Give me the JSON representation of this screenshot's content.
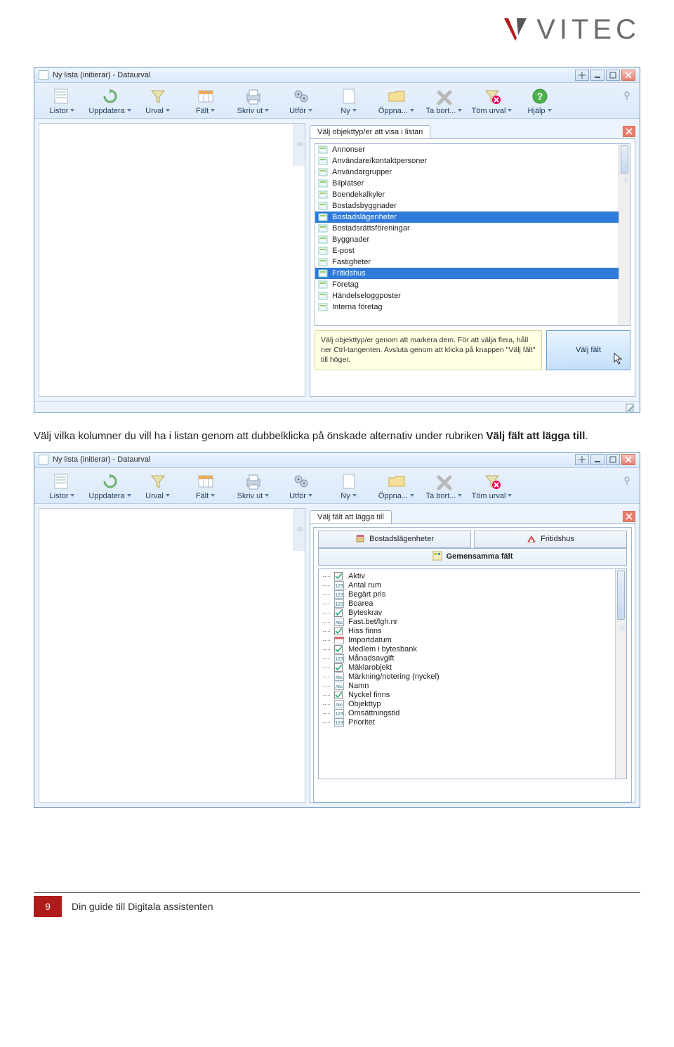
{
  "brand": {
    "name": "VITEC"
  },
  "paragraph": {
    "prefix": "Välj vilka kolumner du vill ha i listan genom att dubbelklicka på önskade alternativ under rubriken ",
    "bold": "Välj fält att lägga till",
    "suffix": "."
  },
  "footer": {
    "page": "9",
    "title": "Din guide till Digitala assistenten"
  },
  "win1": {
    "title": "Ny lista (initierar) - Dataurval",
    "toolbar": [
      {
        "label": "Listor"
      },
      {
        "label": "Uppdatera"
      },
      {
        "label": "Urval"
      },
      {
        "label": "Fält"
      },
      {
        "label": "Skriv ut"
      },
      {
        "label": "Utför"
      },
      {
        "label": "Ny"
      },
      {
        "label": "Öppna..."
      },
      {
        "label": "Ta bort..."
      },
      {
        "label": "Töm urval"
      },
      {
        "label": "Hjälp"
      }
    ],
    "tab": "Välj objekttyp/er att visa i listan",
    "items": [
      {
        "label": "Annonser",
        "sel": false
      },
      {
        "label": "Användare/kontaktpersoner",
        "sel": false
      },
      {
        "label": "Användargrupper",
        "sel": false
      },
      {
        "label": "Bilplatser",
        "sel": false
      },
      {
        "label": "Boendekalkyler",
        "sel": false
      },
      {
        "label": "Bostadsbyggnader",
        "sel": false
      },
      {
        "label": "Bostadslägenheter",
        "sel": true
      },
      {
        "label": "Bostadsrättsföreningar",
        "sel": false
      },
      {
        "label": "Byggnader",
        "sel": false
      },
      {
        "label": "E-post",
        "sel": false
      },
      {
        "label": "Fastigheter",
        "sel": false
      },
      {
        "label": "Fritidshus",
        "sel": true
      },
      {
        "label": "Företag",
        "sel": false
      },
      {
        "label": "Händelseloggposter",
        "sel": false
      },
      {
        "label": "Interna företag",
        "sel": false
      }
    ],
    "hint": "Välj objekttyp/er genom att markera dem. För att välja flera, håll ner Ctrl-tangenten. Avsluta genom att klicka på knappen \"Välj fält\" till höger.",
    "button": "Välj fält"
  },
  "win2": {
    "title": "Ny lista (initierar) - Dataurval",
    "toolbar": [
      {
        "label": "Listor"
      },
      {
        "label": "Uppdatera"
      },
      {
        "label": "Urval"
      },
      {
        "label": "Fält"
      },
      {
        "label": "Skriv ut"
      },
      {
        "label": "Utför"
      },
      {
        "label": "Ny"
      },
      {
        "label": "Öppna..."
      },
      {
        "label": "Ta bort..."
      },
      {
        "label": "Töm urval"
      }
    ],
    "tab": "Välj fält att lägga till",
    "tabs2": [
      {
        "label": "Bostadslägenheter"
      },
      {
        "label": "Fritidshus"
      }
    ],
    "group": "Gemensamma fält",
    "fields": [
      "Aktiv",
      "Antal rum",
      "Begärt pris",
      "Boarea",
      "Byteskrav",
      "Fast.bet/lgh.nr",
      "Hiss finns",
      "Importdatum",
      "Medlem i bytesbank",
      "Månadsavgift",
      "Mäklarobjekt",
      "Märkning/notering (nyckel)",
      "Namn",
      "Nyckel finns",
      "Objekttyp",
      "Omsättningstid",
      "Prioritet"
    ]
  }
}
